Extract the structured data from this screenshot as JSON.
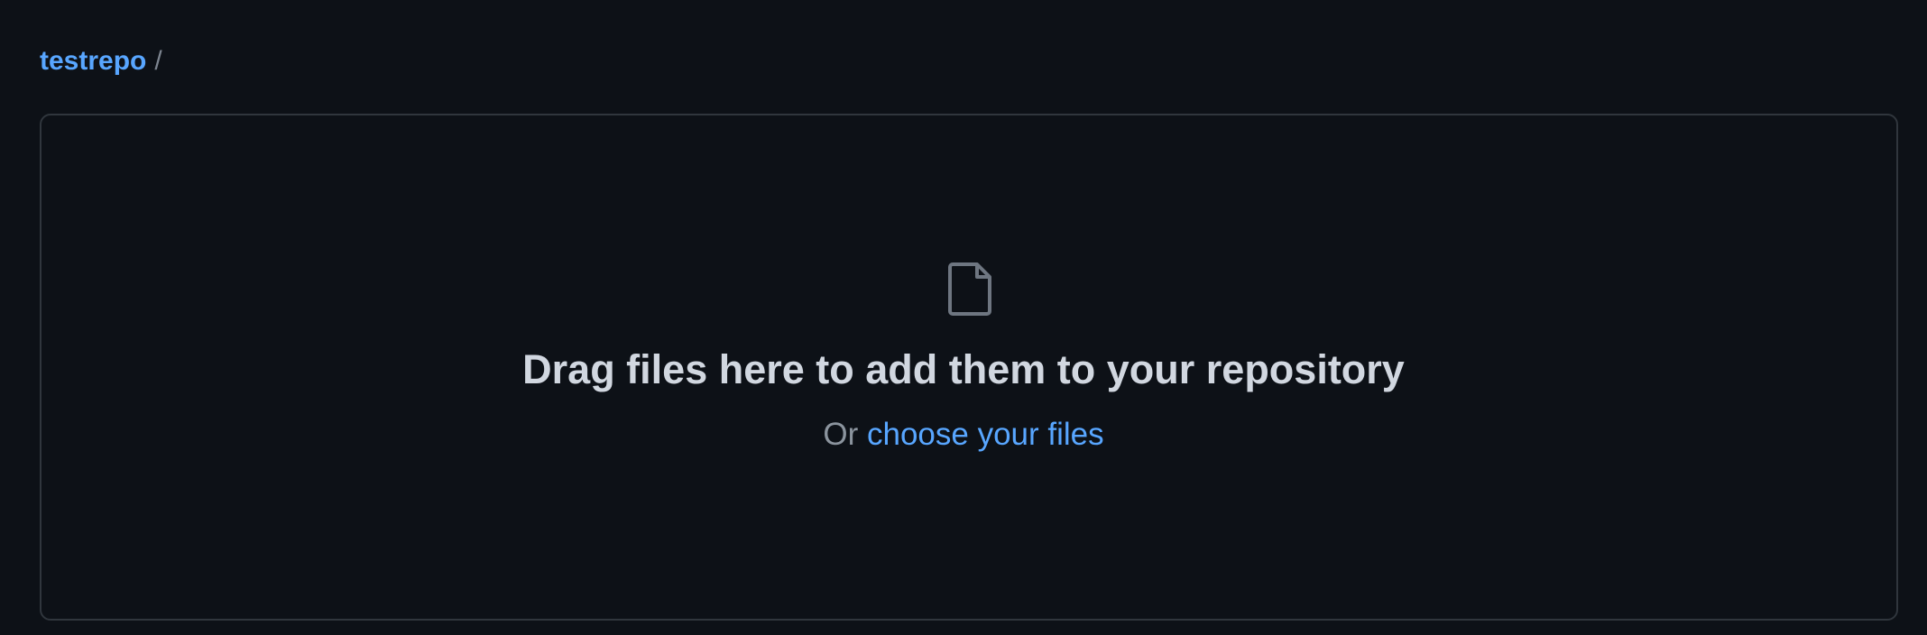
{
  "breadcrumb": {
    "repo_name": "testrepo",
    "separator": "/"
  },
  "dropzone": {
    "icon": "file-icon",
    "headline": "Drag files here to add them to your repository",
    "or_text": "Or",
    "choose_link": "choose your files"
  },
  "colors": {
    "background": "#0d1117",
    "link": "#58a6ff",
    "border": "#30363d",
    "headline": "#d1d7e0",
    "muted": "#8b949e"
  }
}
